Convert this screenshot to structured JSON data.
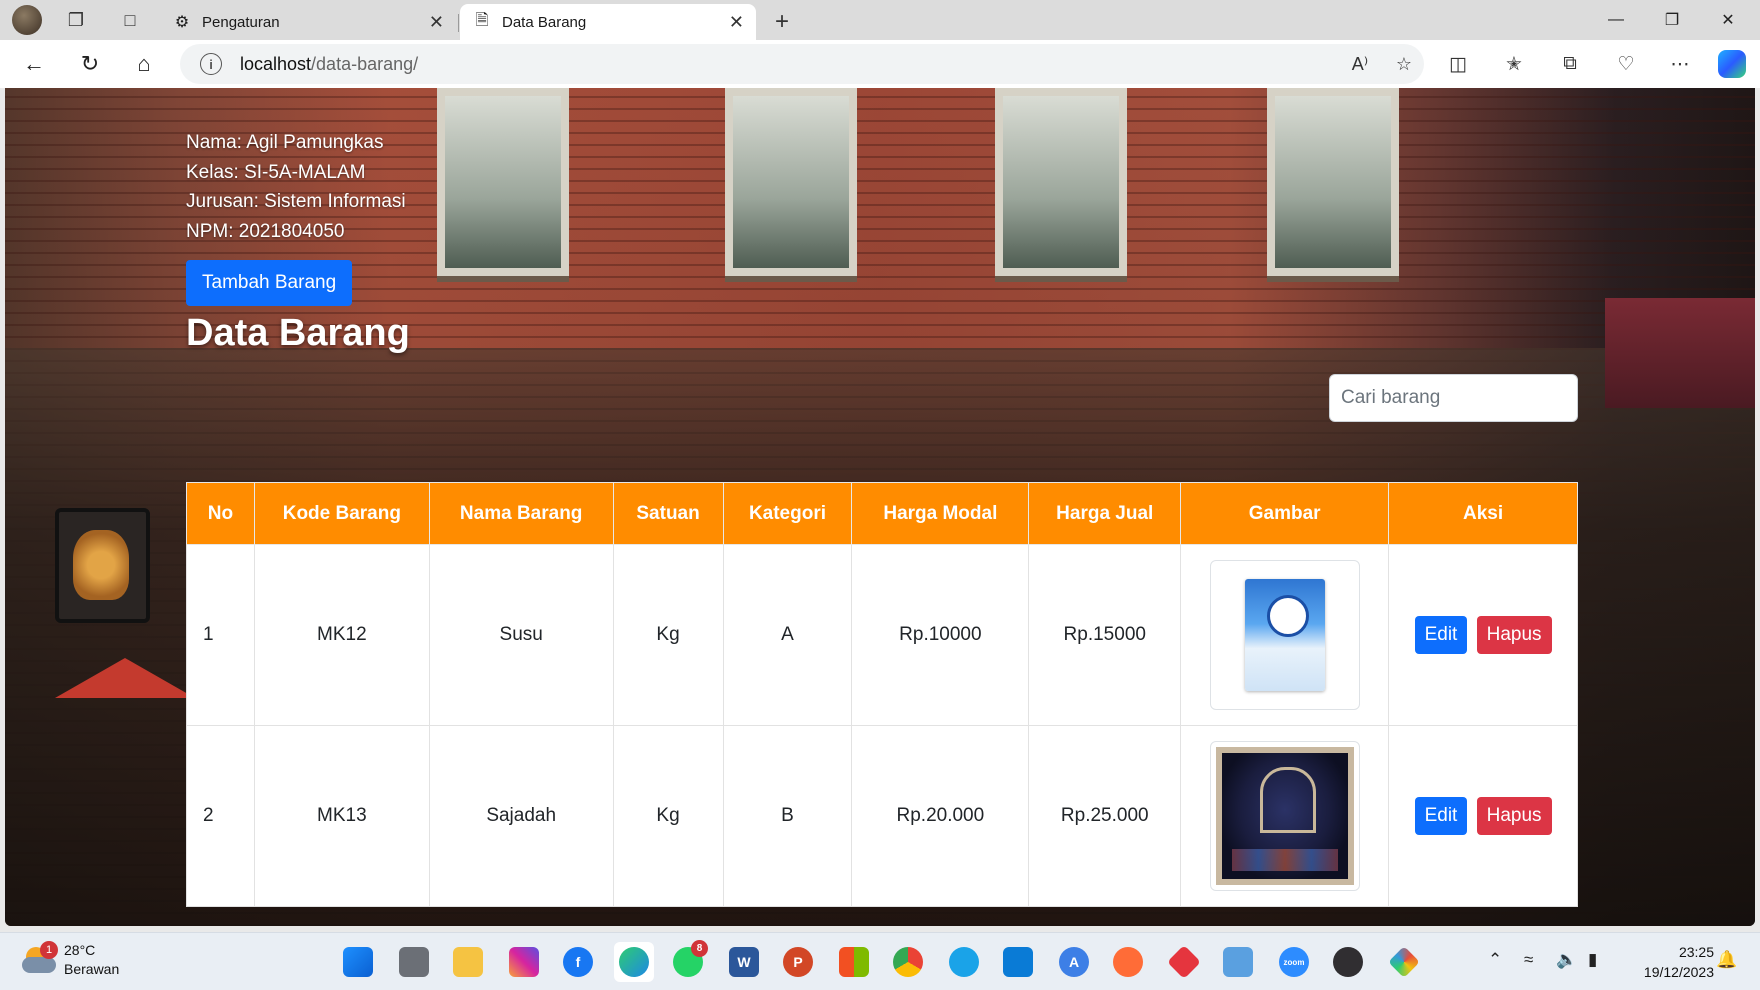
{
  "browser": {
    "tabs": [
      {
        "label": "Pengaturan",
        "icon": "gear-icon"
      },
      {
        "label": "Data Barang",
        "icon": "page-icon"
      }
    ],
    "url_host": "localhost",
    "url_path": "/data-barang/"
  },
  "page": {
    "student": {
      "nama": "Nama: Agil Pamungkas",
      "kelas": "Kelas: SI-5A-MALAM",
      "jurusan": "Jurusan: Sistem Informasi",
      "npm": "NPM: 2021804050"
    },
    "add_button": "Tambah Barang",
    "title": "Data Barang",
    "search_placeholder": "Cari barang",
    "table": {
      "headers": [
        "No",
        "Kode Barang",
        "Nama Barang",
        "Satuan",
        "Kategori",
        "Harga Modal",
        "Harga Jual",
        "Gambar",
        "Aksi"
      ],
      "rows": [
        {
          "no": "1",
          "kode": "MK12",
          "nama": "Susu",
          "satuan": "Kg",
          "kategori": "A",
          "modal": "Rp.10000",
          "jual": "Rp.15000",
          "gambar": "milk-can-image",
          "edit": "Edit",
          "hapus": "Hapus"
        },
        {
          "no": "2",
          "kode": "MK13",
          "nama": "Sajadah",
          "satuan": "Kg",
          "kategori": "B",
          "modal": "Rp.20.000",
          "jual": "Rp.25.000",
          "gambar": "prayer-rug-image",
          "edit": "Edit",
          "hapus": "Hapus"
        }
      ]
    }
  },
  "taskbar": {
    "weather_temp": "28°C",
    "weather_desc": "Berawan",
    "weather_badge": "1",
    "whatsapp_badge": "8",
    "time": "23:25",
    "date": "19/12/2023"
  },
  "colors": {
    "header_orange": "#ff8c00",
    "primary_blue": "#0d6efd",
    "danger_red": "#dc3545"
  }
}
